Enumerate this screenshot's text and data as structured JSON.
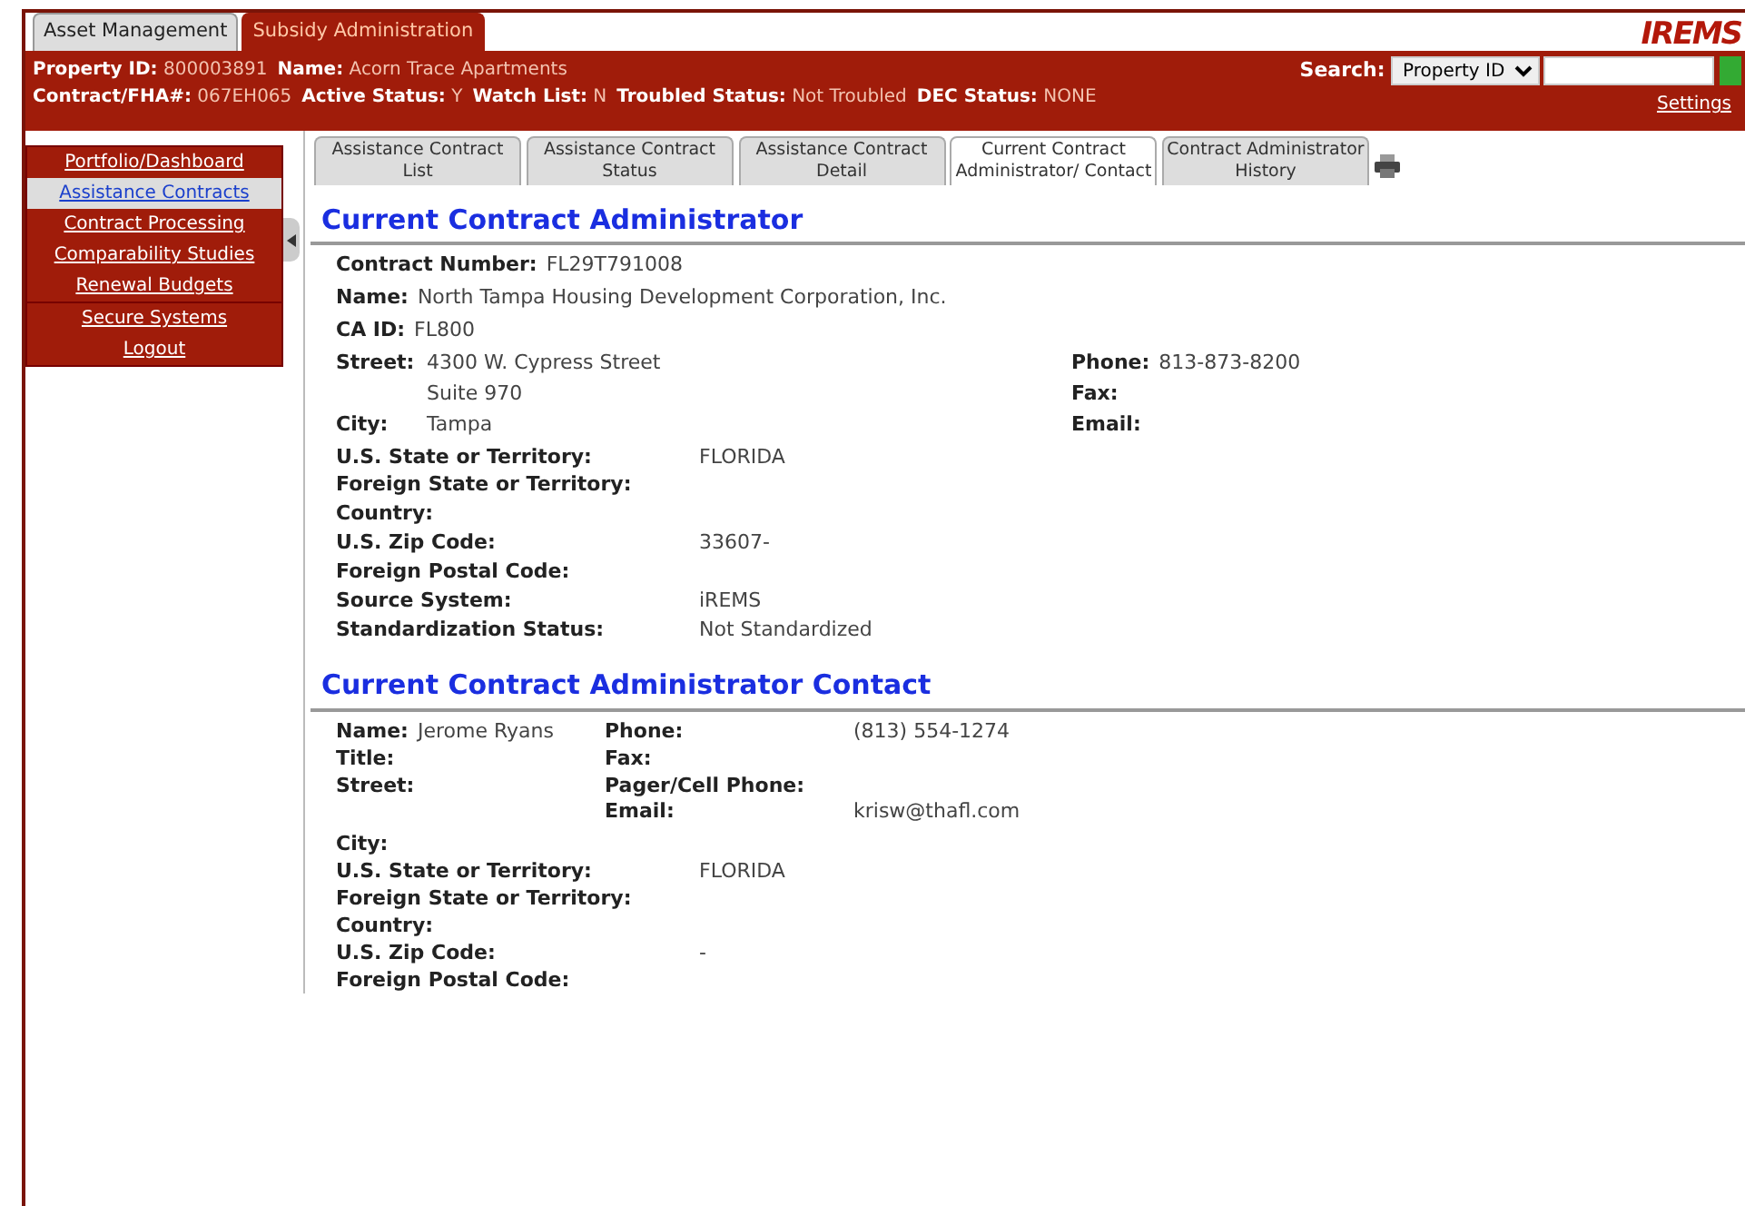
{
  "app_tabs": [
    {
      "label": "Asset Management",
      "selected": false
    },
    {
      "label": "Subsidy Administration",
      "selected": true
    }
  ],
  "logo": "IREMS",
  "header": {
    "line_1": [
      {
        "label": "Property ID:",
        "value": "800003891"
      },
      {
        "label": "Name:",
        "value": "Acorn Trace Apartments"
      }
    ],
    "line_2": [
      {
        "label": "Contract/FHA#:",
        "value": "067EH065"
      },
      {
        "label": "Active Status:",
        "value": "Y"
      },
      {
        "label": "Watch List:",
        "value": "N"
      },
      {
        "label": "Troubled Status:",
        "value": "Not Troubled"
      },
      {
        "label": "DEC Status:",
        "value": "NONE"
      }
    ],
    "search": {
      "label": "Search:",
      "select": "Property ID"
    },
    "settings": "Settings"
  },
  "sidebar": {
    "items": [
      {
        "label": "Portfolio/Dashboard",
        "selected": false
      },
      {
        "label": "Assistance Contracts",
        "selected": true
      },
      {
        "label": "Contract Processing",
        "selected": false
      },
      {
        "label": "Comparability Studies",
        "selected": false
      },
      {
        "label": "Renewal Budgets",
        "selected": false
      },
      {
        "label": "Secure Systems",
        "selected": false
      },
      {
        "label": "Logout",
        "selected": false
      }
    ]
  },
  "tabs": [
    {
      "label": "Assistance Contract List",
      "selected": false
    },
    {
      "label": "Assistance Contract Status",
      "selected": false
    },
    {
      "label": "Assistance Contract Detail",
      "selected": false
    },
    {
      "label": "Current Contract Administrator/ Contact",
      "selected": true
    },
    {
      "label": "Contract Administrator History",
      "selected": false
    }
  ],
  "administrator": {
    "title": "Current Contract Administrator",
    "top": [
      {
        "label": "Contract Number:",
        "value": "FL29T791008"
      },
      {
        "label": "Name:",
        "value": "North Tampa Housing Development Corporation, Inc."
      },
      {
        "label": "CA ID:",
        "value": "FL800"
      }
    ],
    "address_left": [
      {
        "label": "Street:",
        "value": "4300 W. Cypress Street"
      },
      {
        "value": "Suite 970"
      },
      {
        "label": "City:",
        "value": "Tampa"
      }
    ],
    "address_right": [
      {
        "label": "Phone:",
        "value": "813-873-8200"
      },
      {
        "label": "Fax:"
      },
      {
        "label": "Email:"
      }
    ],
    "details": [
      {
        "label": "U.S. State or Territory:",
        "value": "FLORIDA"
      },
      {
        "label": "Foreign State or Territory:"
      },
      {
        "label": "Country:"
      },
      {
        "label": "U.S. Zip Code:",
        "value": "33607-"
      },
      {
        "label": "Foreign Postal Code:"
      },
      {
        "label": "Source System:",
        "value": "iREMS"
      },
      {
        "label": "Standardization Status:",
        "value": "Not Standardized"
      }
    ]
  },
  "contact": {
    "title": "Current Contract Administrator Contact",
    "left": [
      {
        "label": "Name:",
        "value": "Jerome Ryans"
      },
      {
        "label": "Title:"
      },
      {
        "label": "Street:"
      }
    ],
    "right": [
      {
        "label": "Phone:",
        "value": "(813) 554-1274"
      },
      {
        "label": "Fax:"
      },
      {
        "label": "Pager/Cell Phone:"
      },
      {
        "label": "Email:",
        "value": "krisw@thafl.com"
      }
    ],
    "details": [
      {
        "label": "City:"
      },
      {
        "label": "U.S. State or Territory:",
        "value": "FLORIDA"
      },
      {
        "label": "Foreign State or Territory:"
      },
      {
        "label": "Country:"
      },
      {
        "label": "U.S. Zip Code:",
        "value": "-"
      },
      {
        "label": "Foreign Postal Code:"
      }
    ]
  }
}
